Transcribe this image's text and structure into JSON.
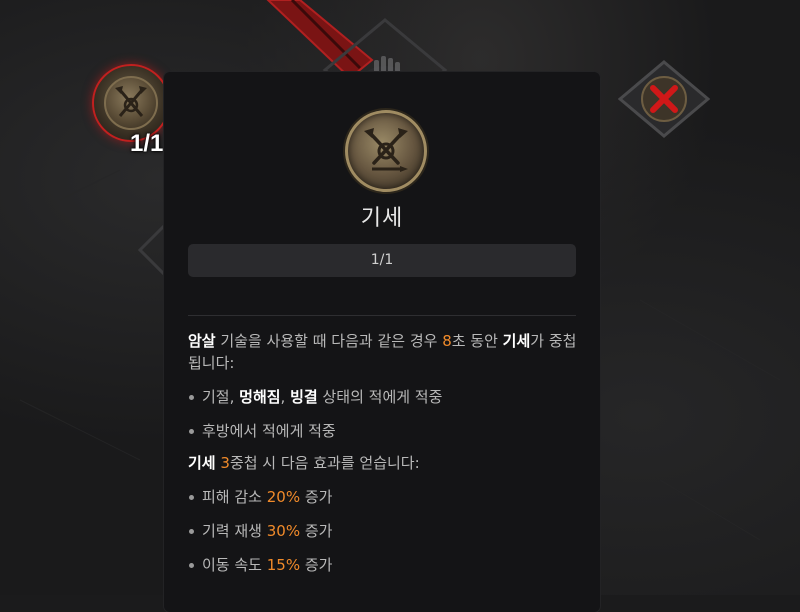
{
  "tree_node": {
    "count_label": "1/1"
  },
  "tooltip": {
    "skill_name": "기세",
    "rank": "1/1",
    "description": {
      "p1_kw1": "암살",
      "p1_t1": " 기술을 사용할 때 다음과 같은 경우 ",
      "p1_num1": "8",
      "p1_t2": "초 동안 ",
      "p1_kw2": "기세",
      "p1_t3": "가 중첩됩니다:",
      "b1_t1": "기절, ",
      "b1_kw1": "멍해짐",
      "b1_t2": ", ",
      "b1_kw2": "빙결",
      "b1_t3": " 상태의 적에게 적중",
      "b2": "후방에서 적에게 적중",
      "p2_kw1": "기세",
      "p2_num1": "3",
      "p2_t1": "중첩 시 다음 효과를 얻습니다:",
      "e1_t1": "피해 감소 ",
      "e1_num": "20%",
      "e1_t2": " 증가",
      "e2_t1": "기력 재생 ",
      "e2_num": "30%",
      "e2_t2": " 증가",
      "e3_t1": "이동 속도 ",
      "e3_num": "15%",
      "e3_t2": " 증가"
    }
  },
  "colors": {
    "highlight_number": "#f08a2a",
    "keyword": "#ffffff",
    "selected_node_ring": "#c2201f",
    "locked_x": "#d01818"
  },
  "icons": {
    "skill_icon": "crossed-axes-sword-emblem-icon",
    "locked_node_icon": "red-x-icon",
    "bg_node_icon": "hand-icon"
  }
}
